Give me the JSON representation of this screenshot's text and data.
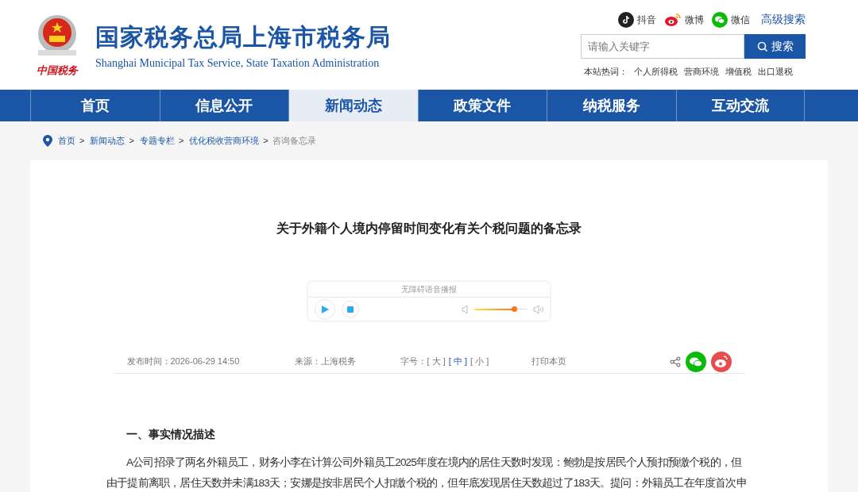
{
  "header": {
    "title": "国家税务总局上海市税务局",
    "subtitle": "Shanghai Municipal Tax Service, State Taxation Administration",
    "emblem_caption": "中国税务",
    "social": [
      {
        "kind": "douyin",
        "label": "抖音"
      },
      {
        "kind": "weibo",
        "label": "微博"
      },
      {
        "kind": "wechat",
        "label": "微信"
      }
    ],
    "advanced_search": "高级搜索",
    "search": {
      "placeholder": "请输入关键字",
      "button": "搜索"
    },
    "hot_label": "本站热词：",
    "hot_words": [
      "个人所得税",
      "营商环境",
      "增值税",
      "出口退税"
    ]
  },
  "nav": [
    {
      "label": "首页",
      "selected": false
    },
    {
      "label": "信息公开",
      "selected": false
    },
    {
      "label": "新闻动态",
      "selected": true
    },
    {
      "label": "政策文件",
      "selected": false
    },
    {
      "label": "纳税服务",
      "selected": false
    },
    {
      "label": "互动交流",
      "selected": false
    }
  ],
  "breadcrumb_separator": ">",
  "breadcrumb": [
    {
      "label": "首页",
      "current": false
    },
    {
      "label": "新闻动态",
      "current": false
    },
    {
      "label": "专题专栏",
      "current": false
    },
    {
      "label": "优化税收营商环境",
      "current": false
    },
    {
      "label": "咨询备忘录",
      "current": true
    }
  ],
  "article": {
    "title": "关于外籍个人境内停留时间变化有关个税问题的备忘录",
    "player": {
      "title": "无障碍语音播报",
      "volume": {
        "level": 0.76
      }
    },
    "meta": {
      "published": "发布时间：2026-06-29 14:50",
      "source": "来源：上海税务",
      "font_label": "字号：",
      "font_sizes": [
        {
          "label": "[ 大 ]",
          "selected": false
        },
        {
          "label": "[ 中 ]",
          "selected": true
        },
        {
          "label": "[ 小 ]",
          "selected": false
        }
      ],
      "print": "打印本页"
    },
    "heading": "一、事实情况描述",
    "paragraph": "A公司招录了两名外籍员工，财务小李在计算公司外籍员工2025年度在境内的居住天数时发现：鲍勃是按居民个人预扣预缴个税的，但由于提前离职，居住天数并未满183天；安娜是按非居民个人扣缴个税的，但年底发现居住天数超过了183天。提问：外籍员工在年度首次申"
  }
}
